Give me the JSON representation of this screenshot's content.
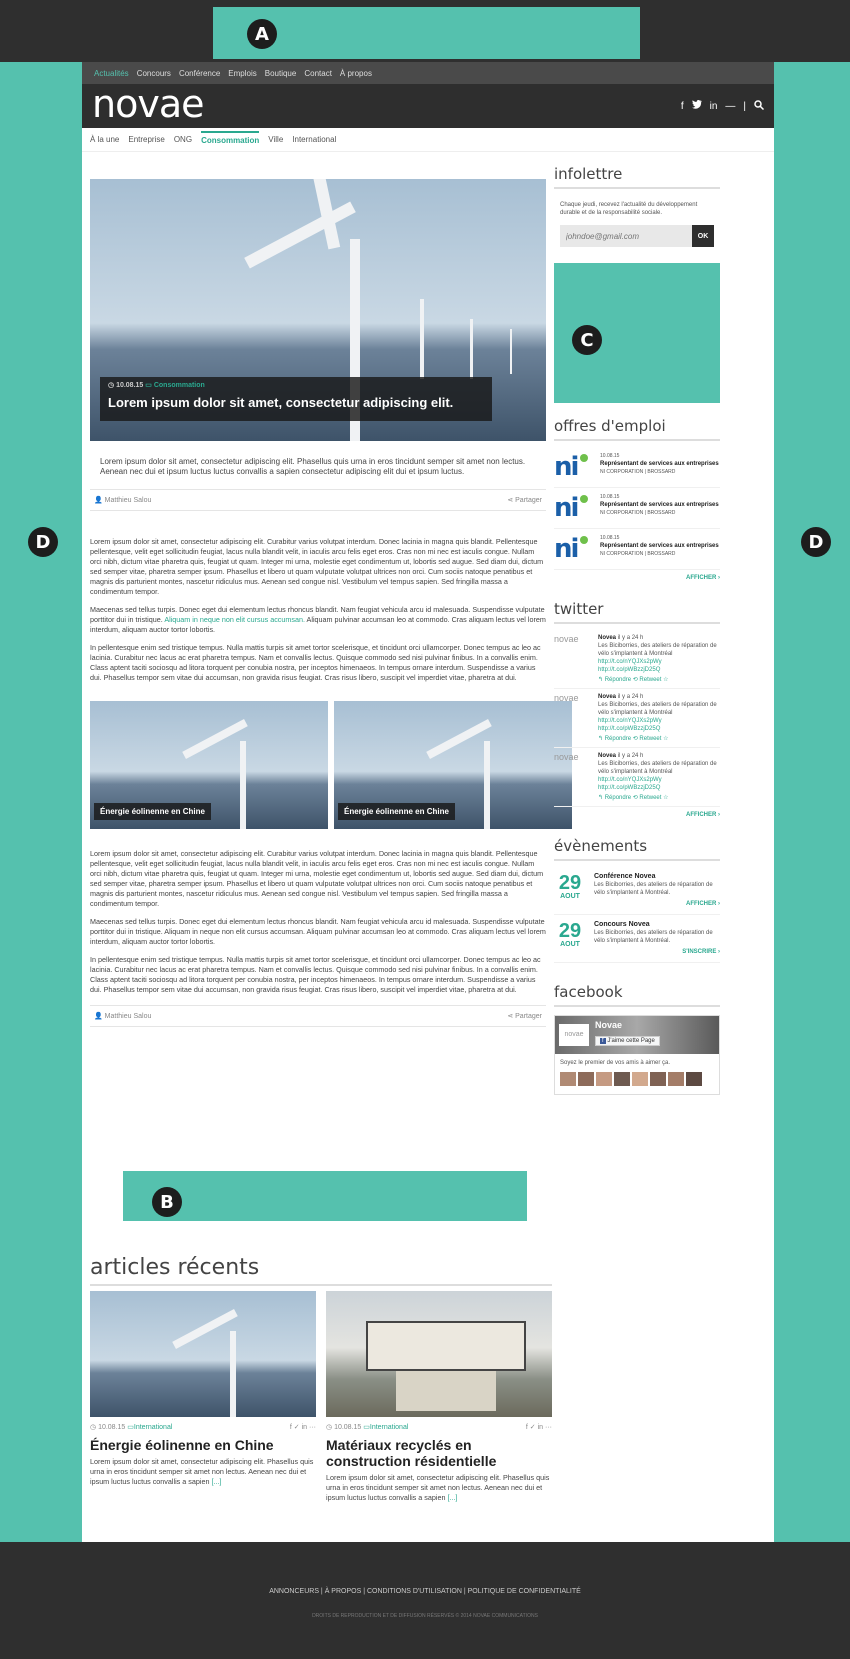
{
  "badges": {
    "a": "A",
    "b": "B",
    "c": "C",
    "d_left": "D",
    "d_right": "D"
  },
  "colors": {
    "accent": "#55c1ae",
    "link": "#2aa88f",
    "dark": "#2e2e2e"
  },
  "topnav": [
    "Actualités",
    "Concours",
    "Conférence",
    "Emplois",
    "Boutique",
    "Contact",
    "À propos"
  ],
  "logo": "novae",
  "social": [
    "f",
    "t",
    "in",
    "—",
    "|",
    "search-icon"
  ],
  "catnav": [
    "À la une",
    "Entreprise",
    "ONG",
    "Consommation",
    "Ville",
    "International"
  ],
  "hero": {
    "date": "10.08.15",
    "category": "Consommation",
    "title": "Lorem ipsum dolor sit amet, consectetur adipiscing elit.",
    "lead": "Lorem ipsum dolor sit amet, consectetur adipiscing elit. Phasellus quis urna in eros tincidunt semper sit amet non lectus. Aenean nec dui et ipsum luctus luctus convallis a sapien consectetur adipiscing elit dui et ipsum luctus."
  },
  "author": "Matthieu Salou",
  "share": "Partager",
  "paragraphs": {
    "p1": "Lorem ipsum dolor sit amet, consectetur adipiscing elit. Curabitur varius volutpat interdum. Donec lacinia in magna quis blandit. Pellentesque pellentesque, velit eget sollicitudin feugiat, lacus nulla blandit velit, in iaculis arcu felis eget eros. Cras non mi nec est iaculis congue. Nullam orci nibh, dictum vitae pharetra quis, feugiat ut quam. Integer mi urna, molestie eget condimentum ut, lobortis sed augue. Sed diam dui, dictum sed semper vitae, pharetra semper ipsum. Phasellus et libero ut quam vulputate volutpat ultrices non orci. Cum sociis natoque penatibus et magnis dis parturient montes, nascetur ridiculus mus. Aenean sed congue nisl. Vestibulum vel tempus sapien. Sed fringilla massa a condimentum tempor.",
    "p2a": "Maecenas sed tellus turpis. Donec eget dui elementum lectus rhoncus blandit. Nam feugiat vehicula arcu id malesuada. Suspendisse vulputate porttitor dui in tristique. ",
    "p2link": "Aliquam in neque non elit cursus accumsan.",
    "p2b": " Aliquam pulvinar accumsan leo at commodo. Cras aliquam lectus vel lorem interdum, aliquam auctor tortor lobortis.",
    "p2plain": "Maecenas sed tellus turpis. Donec eget dui elementum lectus rhoncus blandit. Nam feugiat vehicula arcu id malesuada. Suspendisse vulputate porttitor dui in tristique. Aliquam in neque non elit cursus accumsan. Aliquam pulvinar accumsan leo at commodo. Cras aliquam lectus vel lorem interdum, aliquam auctor tortor lobortis.",
    "p3": "In pellentesque enim sed tristique tempus. Nulla mattis turpis sit amet tortor scelerisque, et tincidunt orci ullamcorper. Donec tempus ac leo ac lacinia. Curabitur nec lacus ac erat pharetra tempus. Nam et convallis lectus. Quisque commodo sed nisi pulvinar finibus. In a convallis enim. Class aptent taciti sociosqu ad litora torquent per conubia nostra, per inceptos himenaeos. In tempus ornare interdum. Suspendisse a varius dui. Phasellus tempor sem vitae dui accumsan, non gravida risus feugiat. Cras risus libero, suscipit vel imperdiet vitae, pharetra at dui."
  },
  "gallery_caption": "Énergie éolinenne en Chine",
  "sidebar": {
    "newsletter": {
      "title": "infolettre",
      "text": "Chaque jeudi, recevez l'actualité du développement durable et de la responsabilité sociale.",
      "placeholder": "johndoe@gmail.com",
      "button": "OK"
    },
    "jobs": {
      "title": "offres d'emploi",
      "items": [
        {
          "date": "10.08.15",
          "title": "Représentant de services aux entreprises",
          "company": "NI CORPORATION | BROSSARD"
        },
        {
          "date": "10.08.15",
          "title": "Représentant de services aux entreprises",
          "company": "NI CORPORATION | BROSSARD"
        },
        {
          "date": "10.08.15",
          "title": "Représentant de services aux entreprises",
          "company": "NI CORPORATION | BROSSARD"
        }
      ],
      "more": "AFFICHER ›",
      "logo": "ni"
    },
    "twitter": {
      "title": "twitter",
      "items": [
        {
          "user": "Novea",
          "time": "il y a 24 h",
          "text": "Les Biciborries, des ateliers de réparation de vélo s'implantent à Montréal",
          "link": "http://t.co/nYQJXs2pWy http://t.co/pWBzzjD25Q",
          "actions": "↰ Répondre ⟲ Retweet ☆"
        },
        {
          "user": "Novea",
          "time": "il y a 24 h",
          "text": "Les Biciborries, des ateliers de réparation de vélo s'implantent à Montréal",
          "link": "http://t.co/nYQJXs2pWy http://t.co/pWBzzjD25Q",
          "actions": "↰ Répondre ⟲ Retweet ☆"
        },
        {
          "user": "Novea",
          "time": "il y a 24 h",
          "text": "Les Biciborries, des ateliers de réparation de vélo s'implantent à Montréal",
          "link": "http://t.co/nYQJXs2pWy http://t.co/pWBzzjD25Q",
          "actions": "↰ Répondre ⟲ Retweet ☆"
        }
      ],
      "more": "AFFICHER ›",
      "logo": "novae"
    },
    "events": {
      "title": "évènements",
      "items": [
        {
          "day": "29",
          "month": "AOUT",
          "title": "Conférence Novea",
          "text": "Les Biciborries, des ateliers de réparation de vélo s'implantent à Montréal.",
          "cta": "AFFICHER ›"
        },
        {
          "day": "29",
          "month": "AOUT",
          "title": "Concours Novea",
          "text": "Les Biciborries, des ateliers de réparation de vélo s'implantent à Montréal.",
          "cta": "S'INSCRIRE ›"
        }
      ]
    },
    "facebook": {
      "title": "facebook",
      "page": "Novae",
      "like": "J'aime cette Page",
      "invite": "Soyez le premier de vos amis à aimer ça.",
      "logo": "novae"
    }
  },
  "recent": {
    "title": "articles récents",
    "cards": [
      {
        "date": "10.08.15",
        "category": "International",
        "title": "Énergie éolinenne en Chine",
        "excerpt": "Lorem ipsum dolor sit amet, consectetur adipiscing elit. Phasellus quis urna in eros tincidunt semper sit amet non lectus. Aenean nec dui et ipsum luctus luctus convallis a sapien",
        "more": "[...]"
      },
      {
        "date": "10.08.15",
        "category": "International",
        "title": "Matériaux recyclés en construction résidentielle",
        "excerpt": "Lorem ipsum dolor sit amet, consectetur adipiscing elit. Phasellus quis urna in eros tincidunt semper sit amet non lectus. Aenean nec dui et ipsum luctus luctus convallis a sapien",
        "more": "[...]"
      }
    ],
    "share_icons": "f ✓ in ···"
  },
  "footer": {
    "links": "ANNONCEURS | À PROPOS | CONDITIONS D'UTILISATION | POLITIQUE DE CONFIDENTIALITÉ",
    "copyright": "DROITS DE REPRODUCTION ET DE DIFFUSION RÉSERVÉS © 2014 NOVAE COMMUNICATIONS"
  }
}
